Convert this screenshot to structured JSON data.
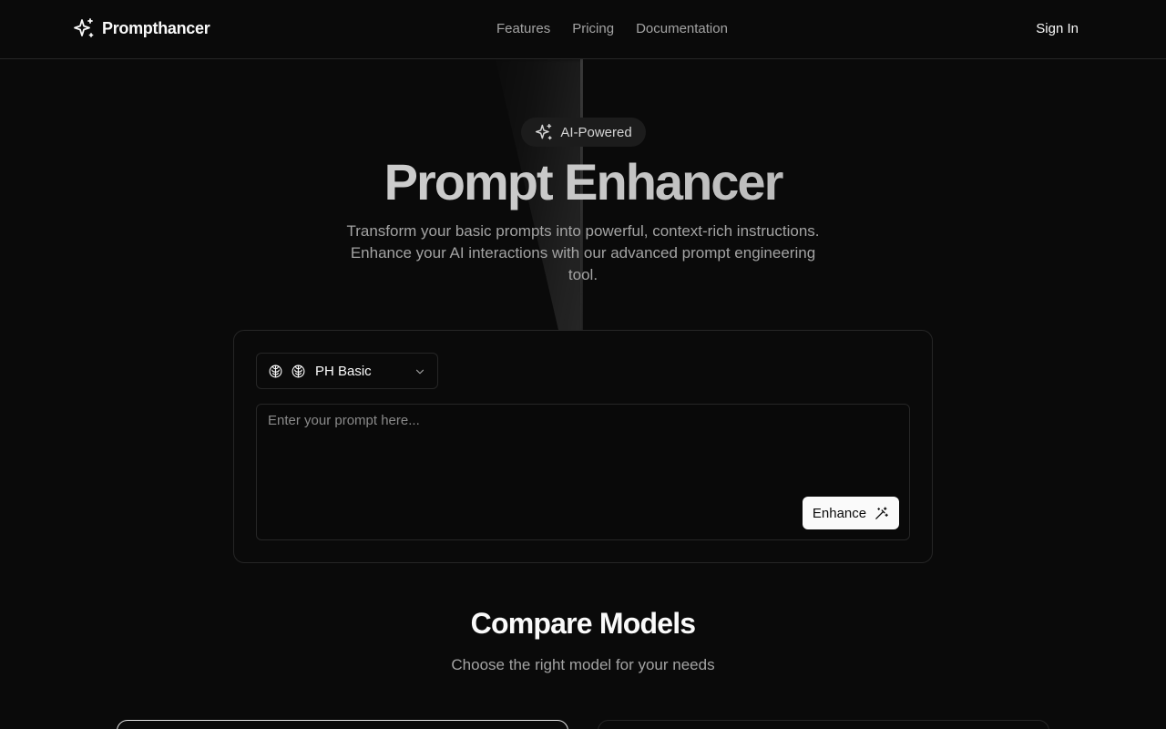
{
  "header": {
    "brand": "Prompthancer",
    "nav": [
      "Features",
      "Pricing",
      "Documentation"
    ],
    "sign_in": "Sign In"
  },
  "hero": {
    "badge": "AI-Powered",
    "title": "Prompt Enhancer",
    "subtitle": "Transform your basic prompts into powerful, context-rich instructions. Enhance your AI interactions with our advanced prompt engineering tool."
  },
  "editor": {
    "model_selected": "PH Basic",
    "prompt_placeholder": "Enter your prompt here...",
    "prompt_value": "",
    "enhance_label": "Enhance"
  },
  "compare": {
    "title": "Compare Models",
    "subtitle": "Choose the right model for your needs"
  },
  "icons": {
    "logo": "sparkles-icon",
    "badge": "sparkles-icon",
    "model": "brain-icon",
    "dropdown": "chevron-down-icon",
    "enhance": "wand-sparkles-icon"
  },
  "colors": {
    "background": "#0a0a0a",
    "border": "#262626",
    "text": "#fafafa",
    "muted": "#a3a3a3",
    "button": "#fafafa"
  }
}
